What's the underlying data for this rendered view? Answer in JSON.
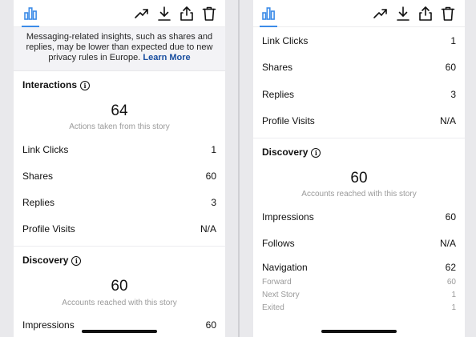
{
  "left": {
    "notice": {
      "text": "Messaging-related insights, such as shares and replies, may be lower than expected due to new privacy rules in Europe.",
      "link": "Learn More"
    },
    "interactions": {
      "title": "Interactions",
      "total": "64",
      "caption": "Actions taken from this story",
      "rows": [
        {
          "label": "Link Clicks",
          "value": "1"
        },
        {
          "label": "Shares",
          "value": "60"
        },
        {
          "label": "Replies",
          "value": "3"
        },
        {
          "label": "Profile Visits",
          "value": "N/A"
        }
      ]
    },
    "discovery": {
      "title": "Discovery",
      "total": "60",
      "caption": "Accounts reached with this story",
      "rows": [
        {
          "label": "Impressions",
          "value": "60"
        }
      ]
    }
  },
  "right": {
    "interactions": {
      "rows": [
        {
          "label": "Link Clicks",
          "value": "1"
        },
        {
          "label": "Shares",
          "value": "60"
        },
        {
          "label": "Replies",
          "value": "3"
        },
        {
          "label": "Profile Visits",
          "value": "N/A"
        }
      ]
    },
    "discovery": {
      "title": "Discovery",
      "total": "60",
      "caption": "Accounts reached with this story",
      "rows": [
        {
          "label": "Impressions",
          "value": "60"
        },
        {
          "label": "Follows",
          "value": "N/A"
        },
        {
          "label": "Navigation",
          "value": "62"
        }
      ],
      "navigation_breakdown": [
        {
          "label": "Forward",
          "value": "60"
        },
        {
          "label": "Next Story",
          "value": "1"
        },
        {
          "label": "Exited",
          "value": "1"
        }
      ]
    }
  },
  "toolbar": {
    "icons": [
      "insights-bar-chart-icon",
      "trending-arrow-icon",
      "download-icon",
      "share-icon",
      "trash-icon"
    ],
    "accent_color": "#3b8be8"
  }
}
